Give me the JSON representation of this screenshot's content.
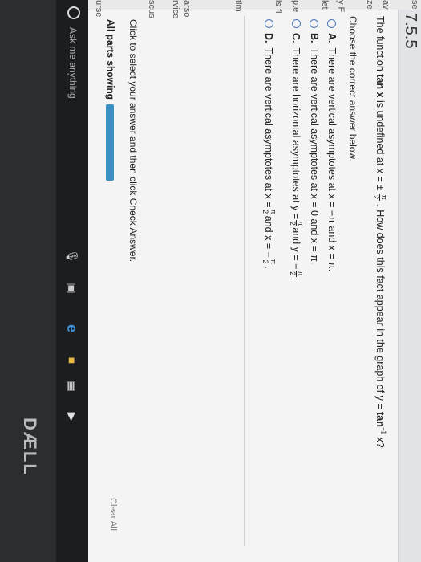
{
  "section": {
    "number": "7.5.5"
  },
  "left_strip": {
    "items": [
      "se",
      "av",
      "ze",
      "y F",
      "let",
      "pte",
      "is fi",
      "tim",
      "arso",
      "rvice",
      "scus",
      "urse"
    ]
  },
  "question": {
    "part1": "The function",
    "func": "tan x",
    "part2": "is undefined at x = ±",
    "frac_num": "π",
    "frac_den": "2",
    "part3": ". How does this fact appear in the graph of y =",
    "inv_func": "tan",
    "inv_sup": "−1",
    "part4": "x?"
  },
  "instruction": "Choose the correct answer below.",
  "options": [
    {
      "letter": "A.",
      "text": "There are vertical asymptotes at x = −π and x = π."
    },
    {
      "letter": "B.",
      "text": "There are vertical asymptotes at x = 0 and x = π."
    },
    {
      "letter": "C.",
      "text_a": "There are horizontal asymptotes at y =",
      "text_b": "and y = −",
      "end": ".",
      "frac_num": "π",
      "frac_den": "2"
    },
    {
      "letter": "D.",
      "text_a": "There are vertical asymptotes at x =",
      "text_b": "and x = −",
      "end": ".",
      "frac_num": "π",
      "frac_den": "2"
    }
  ],
  "footer": {
    "instruction": "Click to select your answer and then click Check Answer.",
    "parts_label": "All parts showing",
    "parts_progress": 1.0,
    "clear_all": "Clear All"
  },
  "taskbar": {
    "search_placeholder": "Ask me anything",
    "icons": [
      "microphone-icon",
      "task-view-icon",
      "edge-icon",
      "file-explorer-icon",
      "store-icon",
      "media-icon"
    ]
  },
  "bezel": {
    "brand": "DÆLL"
  },
  "colors": {
    "accent": "#3a8fc3",
    "radio": "#4a78b5",
    "taskbar": "#1c1d20"
  }
}
